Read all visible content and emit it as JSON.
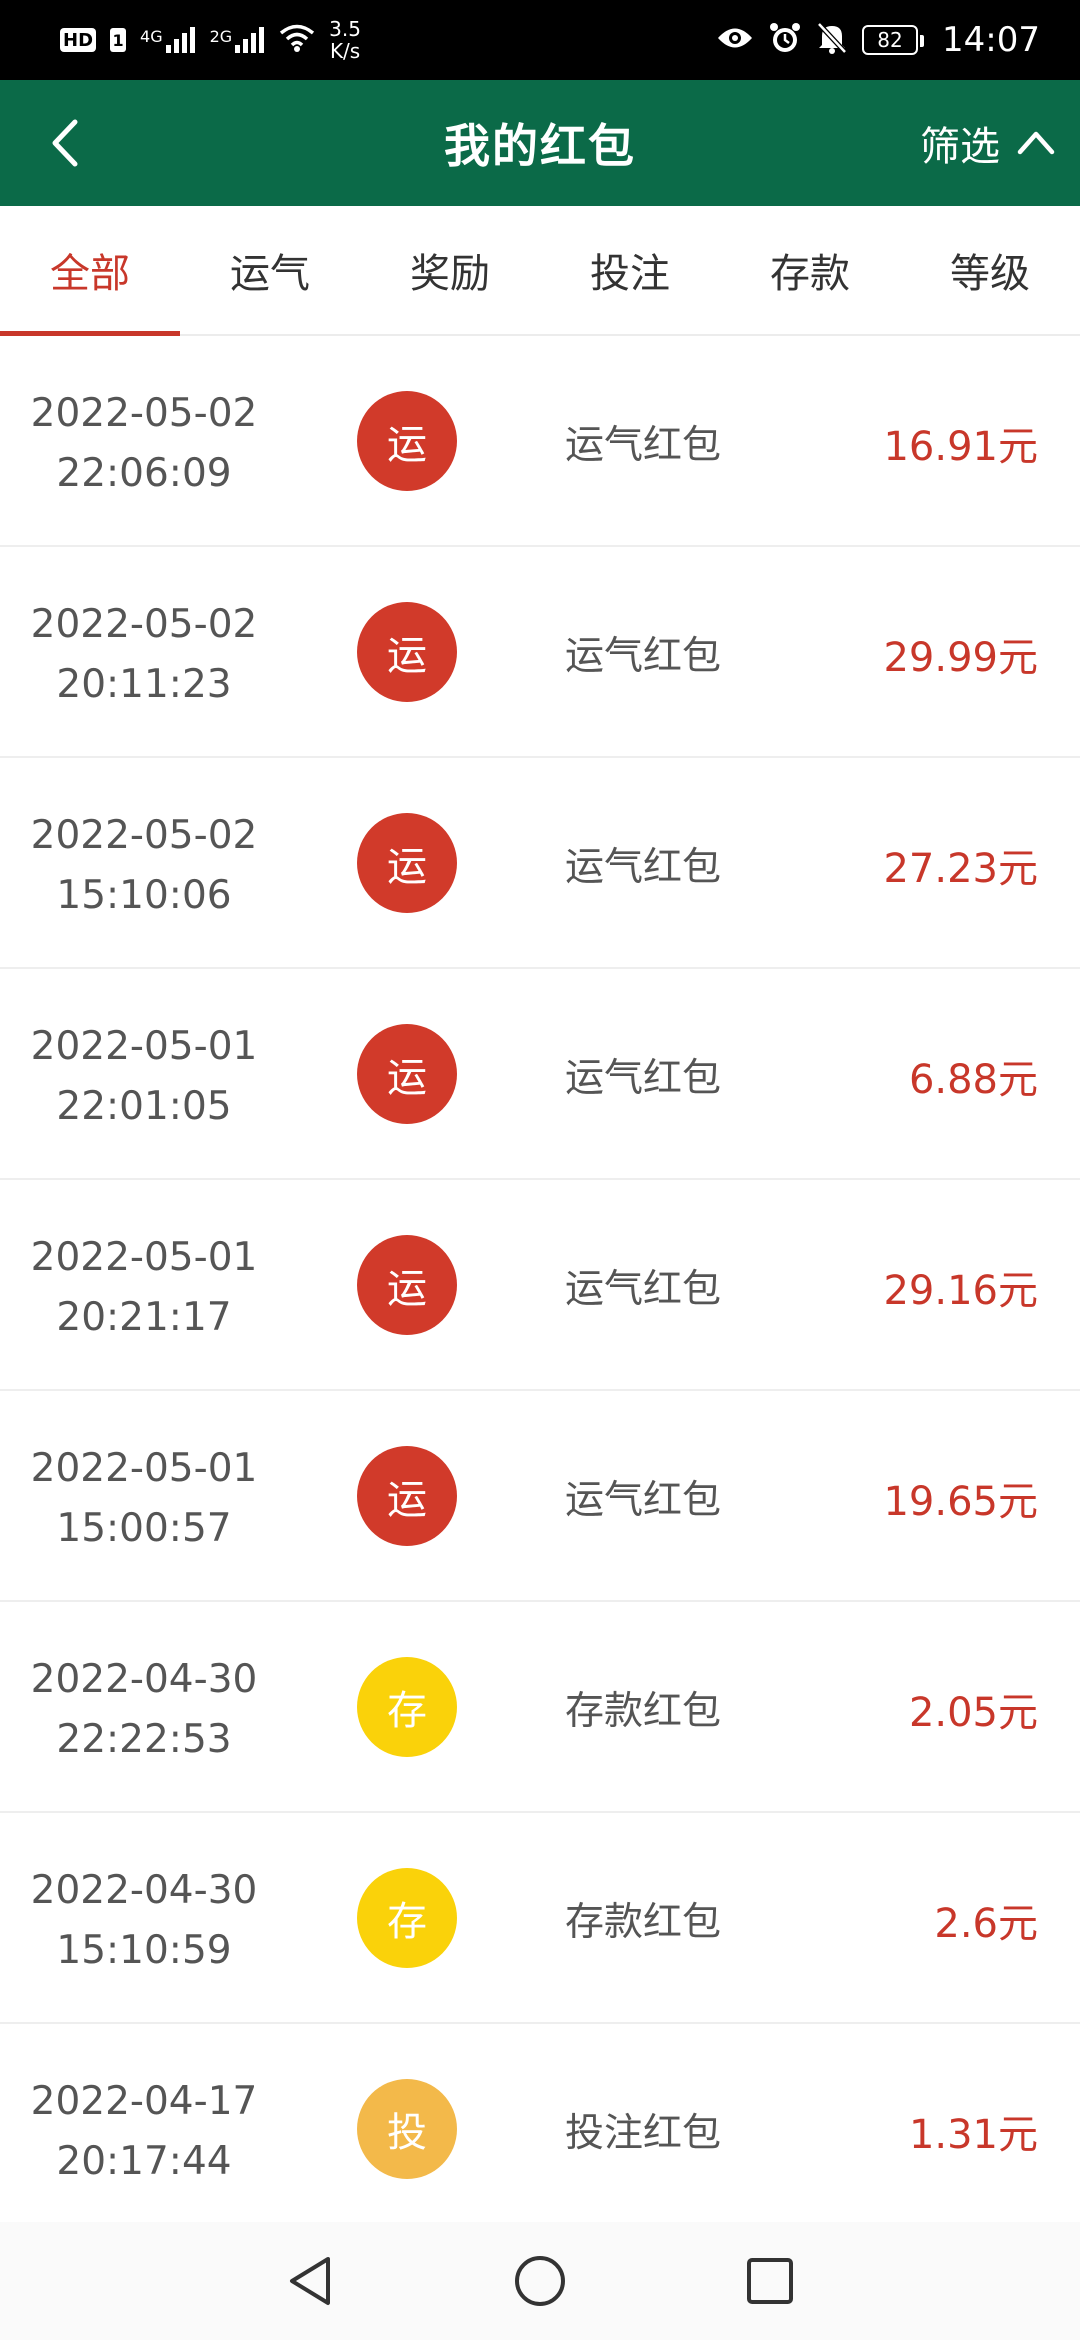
{
  "status_bar": {
    "hd": "HD",
    "sim1": "1",
    "net1": "4G",
    "net2": "2G",
    "speed_value": "3.5",
    "speed_unit": "K/s",
    "battery": "82",
    "time": "14:07"
  },
  "header": {
    "title": "我的红包",
    "filter_label": "筛选"
  },
  "tabs": [
    {
      "label": "全部",
      "active": true
    },
    {
      "label": "运气",
      "active": false
    },
    {
      "label": "奖励",
      "active": false
    },
    {
      "label": "投注",
      "active": false
    },
    {
      "label": "存款",
      "active": false
    },
    {
      "label": "等级",
      "active": false
    }
  ],
  "badge_colors": {
    "运": "#d13a2a",
    "存": "#fad20a",
    "投": "#f3b94a"
  },
  "records": [
    {
      "date": "2022-05-02",
      "time": "22:06:09",
      "badge": "运",
      "type": "运气红包",
      "amount": "16.91元"
    },
    {
      "date": "2022-05-02",
      "time": "20:11:23",
      "badge": "运",
      "type": "运气红包",
      "amount": "29.99元"
    },
    {
      "date": "2022-05-02",
      "time": "15:10:06",
      "badge": "运",
      "type": "运气红包",
      "amount": "27.23元"
    },
    {
      "date": "2022-05-01",
      "time": "22:01:05",
      "badge": "运",
      "type": "运气红包",
      "amount": "6.88元"
    },
    {
      "date": "2022-05-01",
      "time": "20:21:17",
      "badge": "运",
      "type": "运气红包",
      "amount": "29.16元"
    },
    {
      "date": "2022-05-01",
      "time": "15:00:57",
      "badge": "运",
      "type": "运气红包",
      "amount": "19.65元"
    },
    {
      "date": "2022-04-30",
      "time": "22:22:53",
      "badge": "存",
      "type": "存款红包",
      "amount": "2.05元"
    },
    {
      "date": "2022-04-30",
      "time": "15:10:59",
      "badge": "存",
      "type": "存款红包",
      "amount": "2.6元"
    },
    {
      "date": "2022-04-17",
      "time": "20:17:44",
      "badge": "投",
      "type": "投注红包",
      "amount": "1.31元"
    }
  ],
  "icons": {
    "back": "chevron-left-icon",
    "filter": "chevron-up-icon",
    "nav_back": "triangle-back-icon",
    "nav_home": "circle-home-icon",
    "nav_recent": "square-recent-icon"
  }
}
